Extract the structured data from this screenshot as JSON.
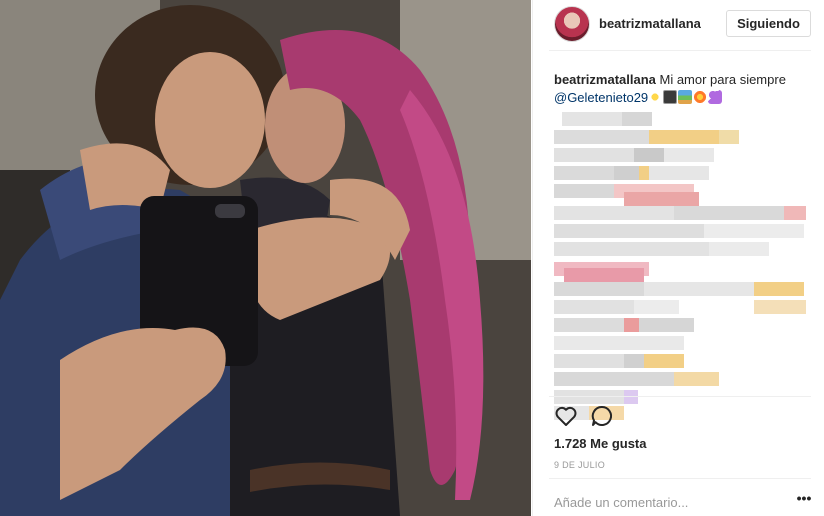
{
  "post": {
    "username": "beatrizmatallana",
    "follow_label": "Siguiendo",
    "caption_user": "beatrizmatallana",
    "caption_text": "Mi amor para siempre",
    "caption_mention": "@Geletenieto29",
    "caption_emoji": [
      "sparkles",
      "night-city",
      "rainbow-landscape",
      "collision",
      "purple-heart"
    ],
    "likes": "1.728 Me gusta",
    "date": "9 DE JULIO",
    "comment_placeholder": "Añade un comentario...",
    "more_label": "•••"
  },
  "icons": {
    "like": "heart-outline-icon",
    "comment": "speech-bubble-icon",
    "more": "more-options-icon"
  },
  "colors": {
    "text": "#262626",
    "muted": "#999999",
    "mention": "#003569",
    "border": "#dbdbdb"
  }
}
